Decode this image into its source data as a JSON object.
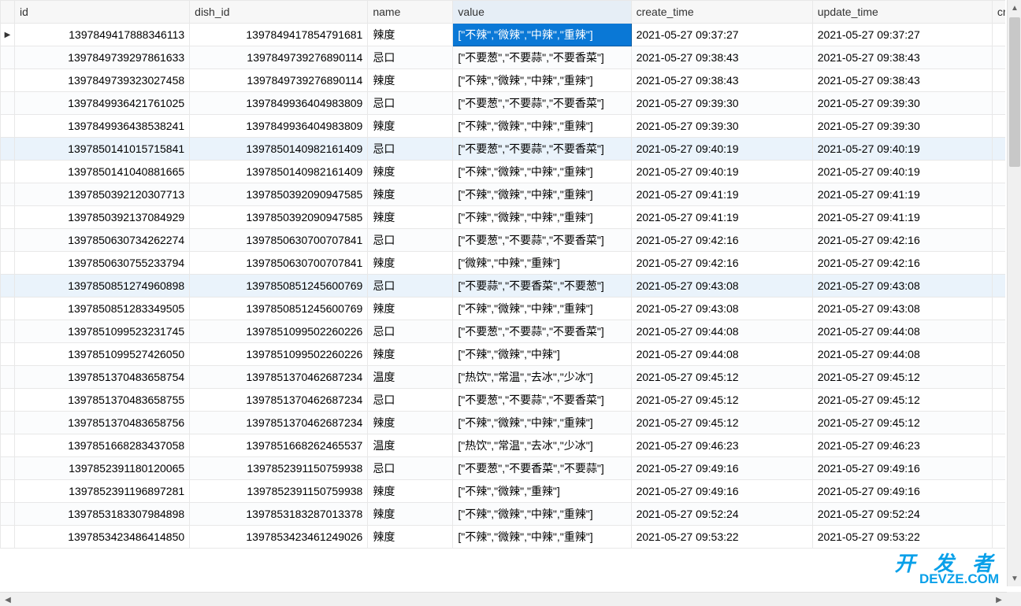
{
  "columns": [
    "id",
    "dish_id",
    "name",
    "value",
    "create_time",
    "update_time",
    "cr"
  ],
  "selected_cell": {
    "row": 0,
    "col": "value"
  },
  "active_row": 0,
  "watermark": {
    "line1": "开 发 者",
    "line2": "DEVZE.COM"
  },
  "rows": [
    {
      "id": "1397849417888346113",
      "dish_id": "1397849417854791681",
      "name": "辣度",
      "value": "[\"不辣\",\"微辣\",\"中辣\",\"重辣\"]",
      "create_time": "2021-05-27 09:37:27",
      "update_time": "2021-05-27 09:37:27"
    },
    {
      "id": "1397849739297861633",
      "dish_id": "1397849739276890114",
      "name": "忌口",
      "value": "[\"不要葱\",\"不要蒜\",\"不要香菜\"]",
      "create_time": "2021-05-27 09:38:43",
      "update_time": "2021-05-27 09:38:43"
    },
    {
      "id": "1397849739323027458",
      "dish_id": "1397849739276890114",
      "name": "辣度",
      "value": "[\"不辣\",\"微辣\",\"中辣\",\"重辣\"]",
      "create_time": "2021-05-27 09:38:43",
      "update_time": "2021-05-27 09:38:43"
    },
    {
      "id": "1397849936421761025",
      "dish_id": "1397849936404983809",
      "name": "忌口",
      "value": "[\"不要葱\",\"不要蒜\",\"不要香菜\"]",
      "create_time": "2021-05-27 09:39:30",
      "update_time": "2021-05-27 09:39:30"
    },
    {
      "id": "1397849936438538241",
      "dish_id": "1397849936404983809",
      "name": "辣度",
      "value": "[\"不辣\",\"微辣\",\"中辣\",\"重辣\"]",
      "create_time": "2021-05-27 09:39:30",
      "update_time": "2021-05-27 09:39:30"
    },
    {
      "id": "1397850141015715841",
      "dish_id": "1397850140982161409",
      "name": "忌口",
      "value": "[\"不要葱\",\"不要蒜\",\"不要香菜\"]",
      "create_time": "2021-05-27 09:40:19",
      "update_time": "2021-05-27 09:40:19"
    },
    {
      "id": "1397850141040881665",
      "dish_id": "1397850140982161409",
      "name": "辣度",
      "value": "[\"不辣\",\"微辣\",\"中辣\",\"重辣\"]",
      "create_time": "2021-05-27 09:40:19",
      "update_time": "2021-05-27 09:40:19"
    },
    {
      "id": "1397850392120307713",
      "dish_id": "1397850392090947585",
      "name": "辣度",
      "value": "[\"不辣\",\"微辣\",\"中辣\",\"重辣\"]",
      "create_time": "2021-05-27 09:41:19",
      "update_time": "2021-05-27 09:41:19"
    },
    {
      "id": "1397850392137084929",
      "dish_id": "1397850392090947585",
      "name": "辣度",
      "value": "[\"不辣\",\"微辣\",\"中辣\",\"重辣\"]",
      "create_time": "2021-05-27 09:41:19",
      "update_time": "2021-05-27 09:41:19"
    },
    {
      "id": "1397850630734262274",
      "dish_id": "1397850630700707841",
      "name": "忌口",
      "value": "[\"不要葱\",\"不要蒜\",\"不要香菜\"]",
      "create_time": "2021-05-27 09:42:16",
      "update_time": "2021-05-27 09:42:16"
    },
    {
      "id": "1397850630755233794",
      "dish_id": "1397850630700707841",
      "name": "辣度",
      "value": "[\"微辣\",\"中辣\",\"重辣\"]",
      "create_time": "2021-05-27 09:42:16",
      "update_time": "2021-05-27 09:42:16"
    },
    {
      "id": "1397850851274960898",
      "dish_id": "1397850851245600769",
      "name": "忌口",
      "value": "[\"不要蒜\",\"不要香菜\",\"不要葱\"]",
      "create_time": "2021-05-27 09:43:08",
      "update_time": "2021-05-27 09:43:08"
    },
    {
      "id": "1397850851283349505",
      "dish_id": "1397850851245600769",
      "name": "辣度",
      "value": "[\"不辣\",\"微辣\",\"中辣\",\"重辣\"]",
      "create_time": "2021-05-27 09:43:08",
      "update_time": "2021-05-27 09:43:08"
    },
    {
      "id": "1397851099523231745",
      "dish_id": "1397851099502260226",
      "name": "忌口",
      "value": "[\"不要葱\",\"不要蒜\",\"不要香菜\"]",
      "create_time": "2021-05-27 09:44:08",
      "update_time": "2021-05-27 09:44:08"
    },
    {
      "id": "1397851099527426050",
      "dish_id": "1397851099502260226",
      "name": "辣度",
      "value": "[\"不辣\",\"微辣\",\"中辣\"]",
      "create_time": "2021-05-27 09:44:08",
      "update_time": "2021-05-27 09:44:08"
    },
    {
      "id": "1397851370483658754",
      "dish_id": "1397851370462687234",
      "name": "温度",
      "value": "[\"热饮\",\"常温\",\"去冰\",\"少冰\"]",
      "create_time": "2021-05-27 09:45:12",
      "update_time": "2021-05-27 09:45:12"
    },
    {
      "id": "1397851370483658755",
      "dish_id": "1397851370462687234",
      "name": "忌口",
      "value": "[\"不要葱\",\"不要蒜\",\"不要香菜\"]",
      "create_time": "2021-05-27 09:45:12",
      "update_time": "2021-05-27 09:45:12"
    },
    {
      "id": "1397851370483658756",
      "dish_id": "1397851370462687234",
      "name": "辣度",
      "value": "[\"不辣\",\"微辣\",\"中辣\",\"重辣\"]",
      "create_time": "2021-05-27 09:45:12",
      "update_time": "2021-05-27 09:45:12"
    },
    {
      "id": "1397851668283437058",
      "dish_id": "1397851668262465537",
      "name": "温度",
      "value": "[\"热饮\",\"常温\",\"去冰\",\"少冰\"]",
      "create_time": "2021-05-27 09:46:23",
      "update_time": "2021-05-27 09:46:23"
    },
    {
      "id": "1397852391180120065",
      "dish_id": "1397852391150759938",
      "name": "忌口",
      "value": "[\"不要葱\",\"不要香菜\",\"不要蒜\"]",
      "create_time": "2021-05-27 09:49:16",
      "update_time": "2021-05-27 09:49:16"
    },
    {
      "id": "1397852391196897281",
      "dish_id": "1397852391150759938",
      "name": "辣度",
      "value": "[\"不辣\",\"微辣\",\"重辣\"]",
      "create_time": "2021-05-27 09:49:16",
      "update_time": "2021-05-27 09:49:16"
    },
    {
      "id": "1397853183307984898",
      "dish_id": "1397853183287013378",
      "name": "辣度",
      "value": "[\"不辣\",\"微辣\",\"中辣\",\"重辣\"]",
      "create_time": "2021-05-27 09:52:24",
      "update_time": "2021-05-27 09:52:24"
    },
    {
      "id": "1397853423486414850",
      "dish_id": "1397853423461249026",
      "name": "辣度",
      "value": "[\"不辣\",\"微辣\",\"中辣\",\"重辣\"]",
      "create_time": "2021-05-27 09:53:22",
      "update_time": "2021-05-27 09:53:22"
    }
  ]
}
